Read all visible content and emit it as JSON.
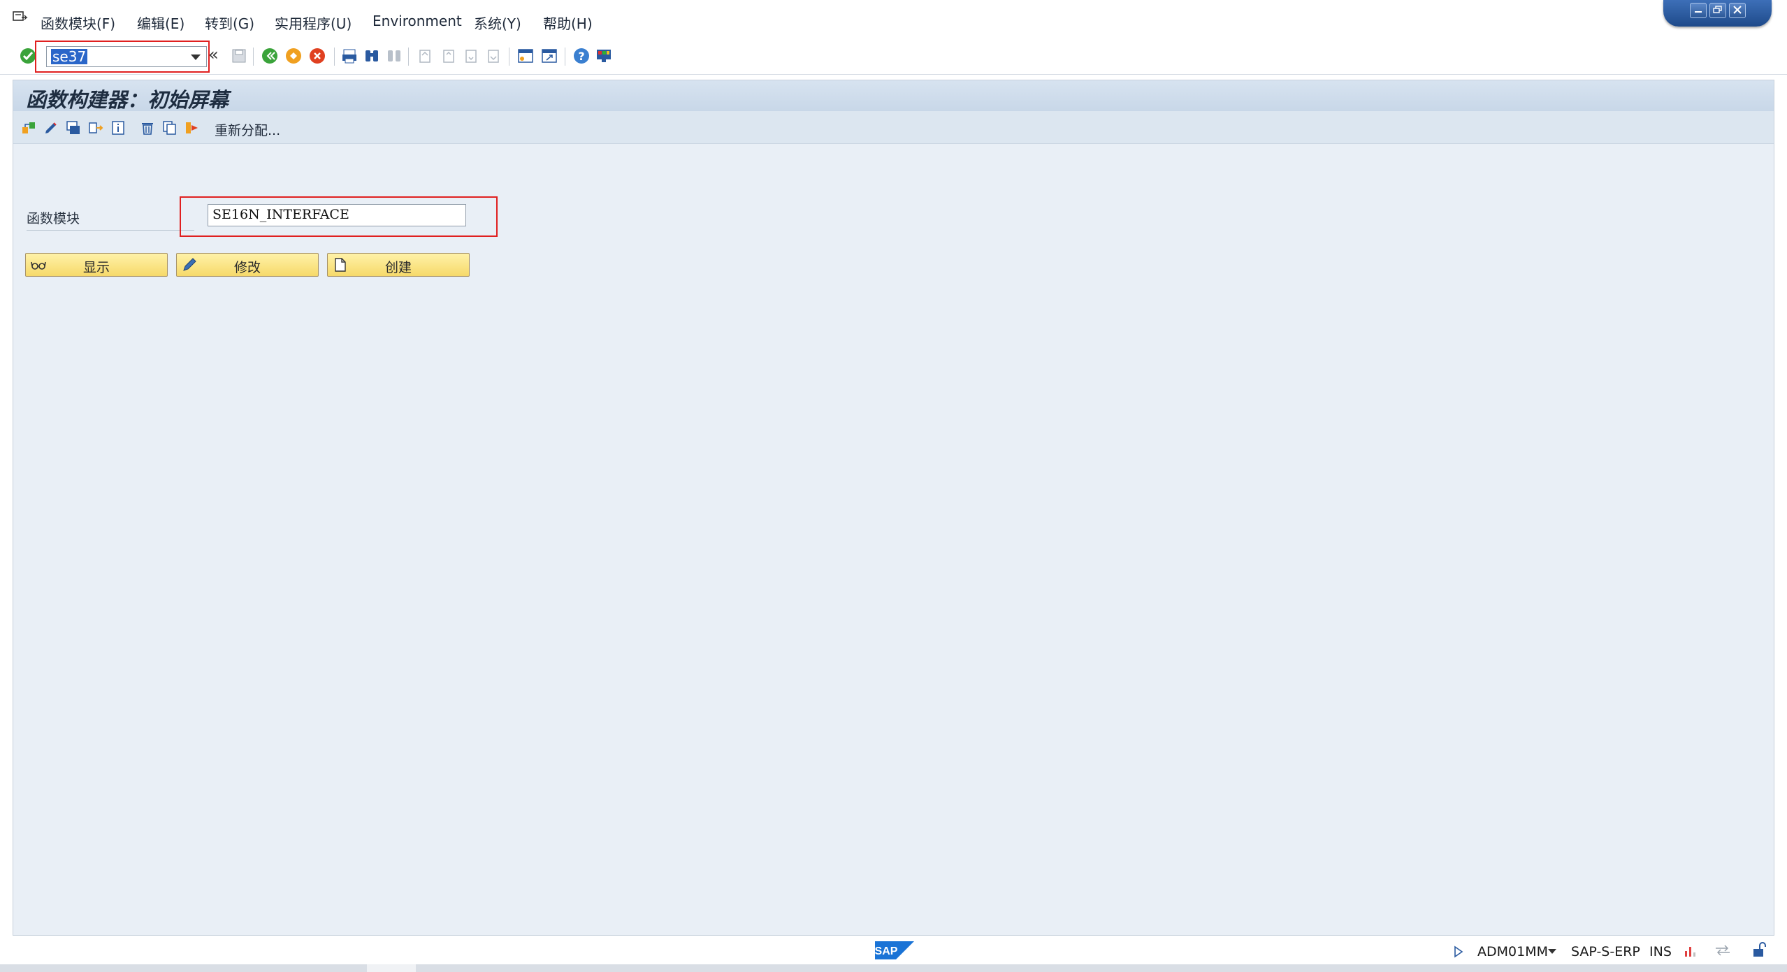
{
  "menu": {
    "items": [
      "函数模块(F)",
      "编辑(E)",
      "转到(G)",
      "实用程序(U)",
      "Environment",
      "系统(Y)",
      "帮助(H)"
    ]
  },
  "toolbar": {
    "command_value": "se37"
  },
  "screen": {
    "title": "函数构建器：初始屏幕",
    "reassign_label": "重新分配..."
  },
  "form": {
    "function_module_label": "函数模块",
    "function_module_value": "SE16N_INTERFACE"
  },
  "buttons": {
    "display": "显示",
    "change": "修改",
    "create": "创建"
  },
  "status": {
    "user": "ADM01MM",
    "system": "SAP-S-ERP",
    "mode": "INS"
  },
  "colors": {
    "highlight": "#e02020",
    "button_yellow": "#f6d96a",
    "background": "#e9eff6"
  }
}
